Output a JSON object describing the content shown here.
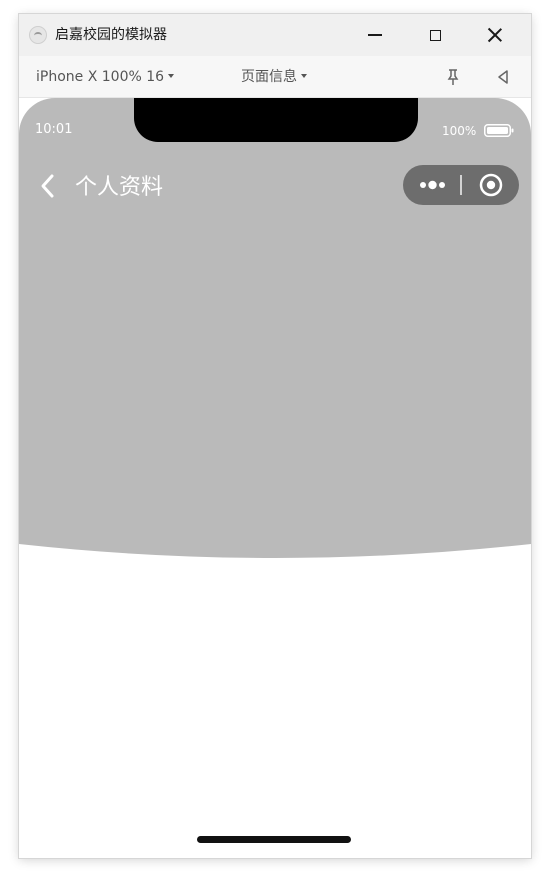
{
  "window": {
    "title": "启嘉校园的模拟器",
    "icon": "simulator-app-icon"
  },
  "toolbar": {
    "device_label": "iPhone X 100% 16",
    "page_info_label": "页面信息",
    "pin_icon": "pin-icon",
    "sound_icon": "speaker-icon"
  },
  "status_bar": {
    "time": "10:01",
    "battery_percent": "100%"
  },
  "nav_bar": {
    "title": "个人资料",
    "back_icon": "chevron-left-icon",
    "capsule_more_icon": "more-dots-icon",
    "capsule_close_icon": "target-circle-icon"
  },
  "colors": {
    "header_background": "#bababa",
    "capsule_background": "#6d6d6d",
    "page_background": "#ffffff"
  }
}
